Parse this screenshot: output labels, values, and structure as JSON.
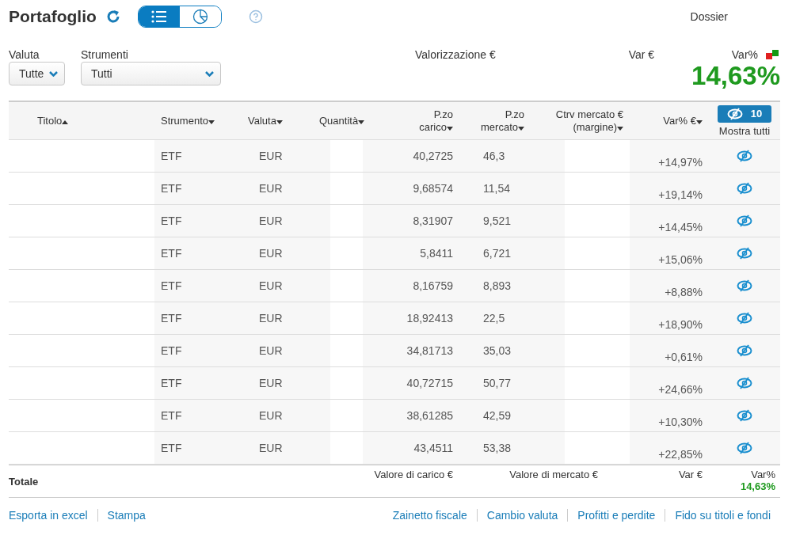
{
  "title": "Portafoglio",
  "view_toggle": [
    {
      "kind": "list",
      "selected": true
    },
    {
      "kind": "pie",
      "selected": false
    }
  ],
  "dossier_label": "Dossier",
  "filters": [
    {
      "label": "Valuta",
      "value": "Tutte"
    },
    {
      "label": "Strumenti",
      "value": "Tutti"
    }
  ],
  "summary": {
    "valuation_label": "Valorizzazione €",
    "var_label": "Var €",
    "var_pct_label": "Var%",
    "var_pct": "14,63%"
  },
  "table": {
    "columns": [
      {
        "label": "Titolo",
        "ascending": true
      },
      {
        "label": "Strumento",
        "ascending": false
      },
      {
        "label": "Valuta",
        "ascending": false
      },
      {
        "label": "Quantità",
        "ascending": false
      },
      {
        "label": "P.zo\ncarico",
        "ascending": false
      },
      {
        "label": "P.zo\nmercato",
        "ascending": false
      },
      {
        "label": "Ctrv mercato €\n(margine)",
        "ascending": false
      },
      {
        "label": "Var% €",
        "ascending": false
      }
    ],
    "hidden_count": "10",
    "show_all": "Mostra tutti",
    "rows": [
      {
        "instrument": "ETF",
        "currency": "EUR",
        "cost_price": "40,2725",
        "market_price": "46,3",
        "var_pct": "+14,97%"
      },
      {
        "instrument": "ETF",
        "currency": "EUR",
        "cost_price": "9,68574",
        "market_price": "11,54",
        "var_pct": "+19,14%"
      },
      {
        "instrument": "ETF",
        "currency": "EUR",
        "cost_price": "8,31907",
        "market_price": "9,521",
        "var_pct": "+14,45%"
      },
      {
        "instrument": "ETF",
        "currency": "EUR",
        "cost_price": "5,8411",
        "market_price": "6,721",
        "var_pct": "+15,06%"
      },
      {
        "instrument": "ETF",
        "currency": "EUR",
        "cost_price": "8,16759",
        "market_price": "8,893",
        "var_pct": "+8,88%"
      },
      {
        "instrument": "ETF",
        "currency": "EUR",
        "cost_price": "18,92413",
        "market_price": "22,5",
        "var_pct": "+18,90%"
      },
      {
        "instrument": "ETF",
        "currency": "EUR",
        "cost_price": "34,81713",
        "market_price": "35,03",
        "var_pct": "+0,61%"
      },
      {
        "instrument": "ETF",
        "currency": "EUR",
        "cost_price": "40,72715",
        "market_price": "50,77",
        "var_pct": "+24,66%"
      },
      {
        "instrument": "ETF",
        "currency": "EUR",
        "cost_price": "38,61285",
        "market_price": "42,59",
        "var_pct": "+10,30%"
      },
      {
        "instrument": "ETF",
        "currency": "EUR",
        "cost_price": "43,4511",
        "market_price": "53,38",
        "var_pct": "+22,85%"
      }
    ],
    "totals": {
      "label": "Totale",
      "cost_label": "Valore di carico €",
      "market_label": "Valore di mercato €",
      "var_label": "Var €",
      "var_pct_label": "Var%",
      "var_pct": "14,63%"
    }
  },
  "links_left": [
    "Esporta in excel",
    "Stampa"
  ],
  "links_right": [
    "Zainetto fiscale",
    "Cambio valuta",
    "Profitti e perdite",
    "Fido su titoli e fondi"
  ]
}
